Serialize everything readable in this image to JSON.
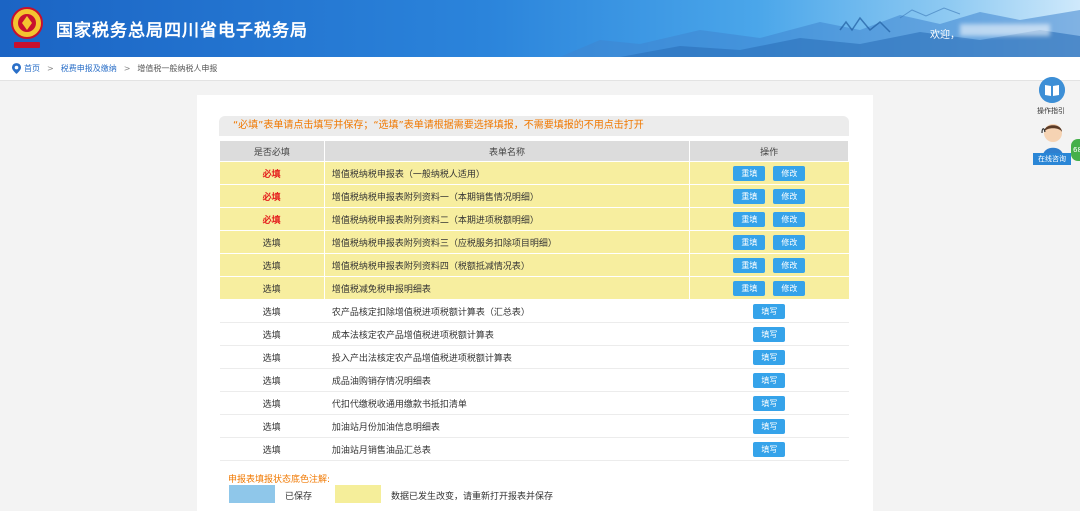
{
  "header": {
    "site_title": "国家税务总局四川省电子税务局",
    "welcome_label": "欢迎，",
    "emblem_subtext": "中国税务"
  },
  "breadcrumb": {
    "home": "首页",
    "section": "税费申报及缴纳",
    "current": "增值税一般纳税人申报"
  },
  "notice": "“必填”表单请点击填写并保存；“选填”表单请根据需要选择填报，不需要填报的不用点击打开",
  "table": {
    "columns": [
      "是否必填",
      "表单名称",
      "操作"
    ],
    "rows": [
      {
        "required": "必填",
        "name": "增值税纳税申报表（一般纳税人适用）",
        "state": "changed",
        "actions": [
          "重填",
          "修改"
        ]
      },
      {
        "required": "必填",
        "name": "增值税纳税申报表附列资料一（本期销售情况明细）",
        "state": "changed",
        "actions": [
          "重填",
          "修改"
        ]
      },
      {
        "required": "必填",
        "name": "增值税纳税申报表附列资料二（本期进项税额明细）",
        "state": "changed",
        "actions": [
          "重填",
          "修改"
        ]
      },
      {
        "required": "选填",
        "name": "增值税纳税申报表附列资料三（应税服务扣除项目明细）",
        "state": "changed",
        "actions": [
          "重填",
          "修改"
        ]
      },
      {
        "required": "选填",
        "name": "增值税纳税申报表附列资料四（税额抵减情况表）",
        "state": "changed",
        "actions": [
          "重填",
          "修改"
        ]
      },
      {
        "required": "选填",
        "name": "增值税减免税申报明细表",
        "state": "changed",
        "actions": [
          "重填",
          "修改"
        ]
      },
      {
        "required": "选填",
        "name": "农产品核定扣除增值税进项税额计算表（汇总表）",
        "state": "none",
        "actions": [
          "填写"
        ]
      },
      {
        "required": "选填",
        "name": "成本法核定农产品增值税进项税额计算表",
        "state": "none",
        "actions": [
          "填写"
        ]
      },
      {
        "required": "选填",
        "name": "投入产出法核定农产品增值税进项税额计算表",
        "state": "none",
        "actions": [
          "填写"
        ]
      },
      {
        "required": "选填",
        "name": "成品油购销存情况明细表",
        "state": "none",
        "actions": [
          "填写"
        ]
      },
      {
        "required": "选填",
        "name": "代扣代缴税收通用缴款书抵扣清单",
        "state": "none",
        "actions": [
          "填写"
        ]
      },
      {
        "required": "选填",
        "name": "加油站月份加油信息明细表",
        "state": "none",
        "actions": [
          "填写"
        ]
      },
      {
        "required": "选填",
        "name": "加油站月销售油品汇总表",
        "state": "none",
        "actions": [
          "填写"
        ]
      }
    ]
  },
  "legend": {
    "title": "申报表填报状态底色注解:",
    "saved": "已保存",
    "changed": "数据已发生改变，请重新打开报表并保存",
    "saved_color": "#8fc7ea",
    "changed_color": "#f5ee9a"
  },
  "side_tools": {
    "guide_label": "操作指引",
    "chat_label": "在线咨询",
    "badge": "68"
  },
  "colors": {
    "accent": "#35a3ea",
    "warning": "#f07800",
    "required": "#e41c1c"
  }
}
